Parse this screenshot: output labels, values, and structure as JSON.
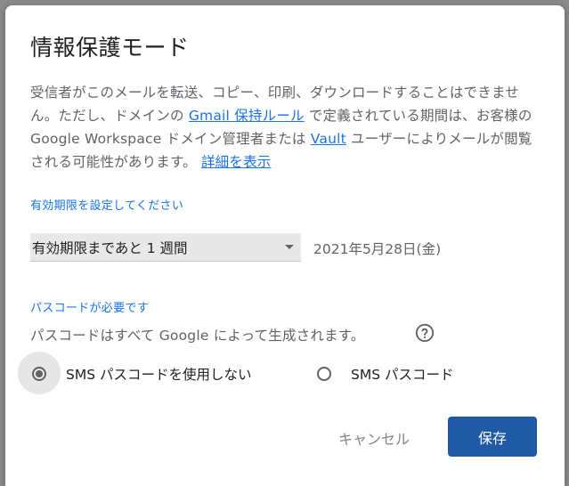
{
  "dialog": {
    "title": "情報保護モード",
    "description": {
      "part1": "受信者がこのメールを転送、コピー、印刷、ダウンロードすることはできません。ただし、ドメインの ",
      "link1": "Gmail 保持ルール",
      "part2": " で定義されている期間は、お客様の Google Workspace ドメイン管理者または ",
      "link2": "Vault",
      "part3": " ユーザーによりメールが閲覧される可能性があります。 ",
      "link3": "詳細を表示"
    },
    "expiry": {
      "label": "有効期限を設定してください",
      "selected": "有効期限まであと 1 週間",
      "date": "2021年5月28日(金)"
    },
    "passcode": {
      "label": "パスコードが必要です",
      "description": "パスコードはすべて Google によって生成されます。",
      "options": [
        {
          "label": "SMS パスコードを使用しない",
          "selected": true
        },
        {
          "label": "SMS パスコード",
          "selected": false
        }
      ]
    },
    "buttons": {
      "cancel": "キャンセル",
      "save": "保存"
    }
  },
  "colors": {
    "accent": "#1a73e8",
    "primary_button": "#1f5aa6",
    "text_secondary": "#5f6368"
  },
  "icons": {
    "help": "help-circle-icon",
    "dropdown": "chevron-down-icon"
  }
}
